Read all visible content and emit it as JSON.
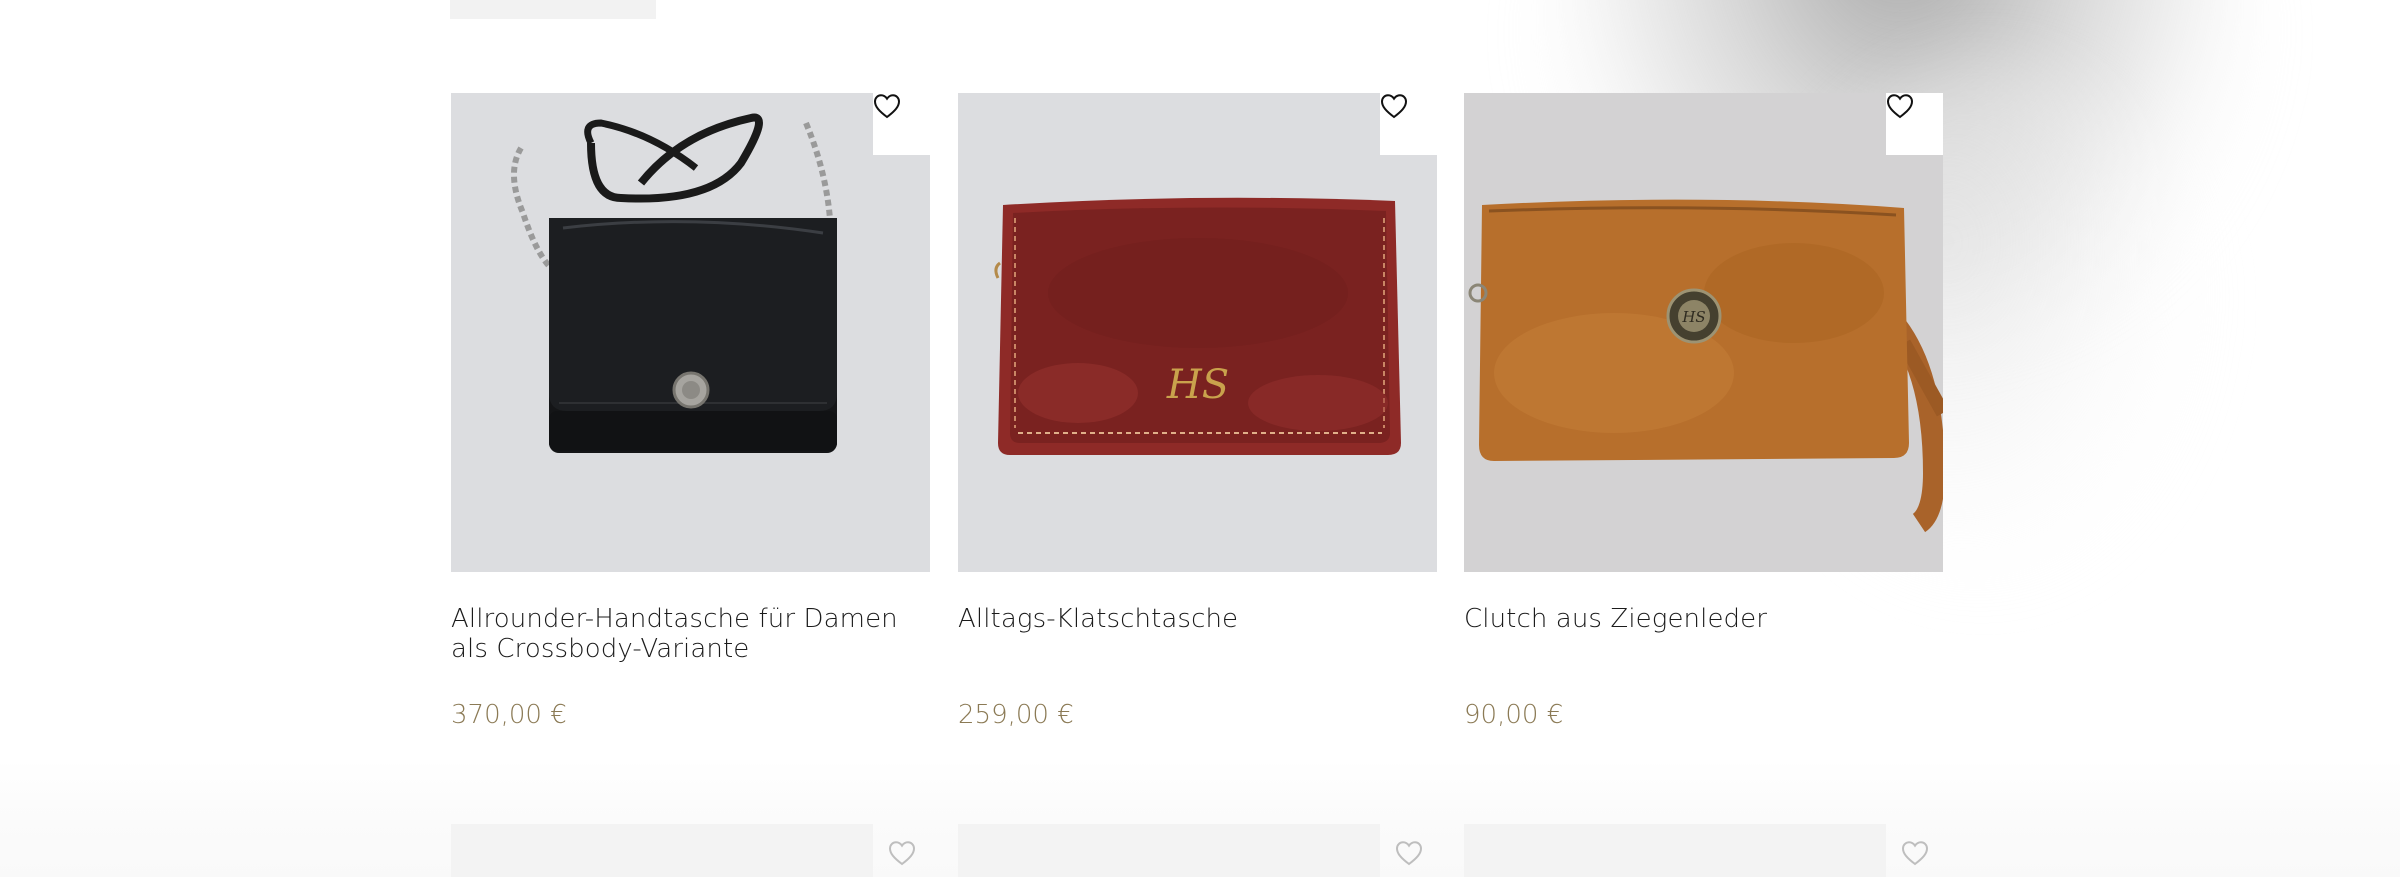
{
  "products": [
    {
      "title": "Allrounder-Handtasche für Damen als Crossbody-Variante",
      "price": "370,00 €",
      "image_alt": "Schwarze Handtasche"
    },
    {
      "title": "Alltags-Klatschtasche",
      "price": "259,00 €",
      "image_alt": "Rote Klatschtasche"
    },
    {
      "title": "Clutch aus Ziegenleder",
      "price": "90,00 €",
      "image_alt": "Braune Clutch aus Ziegenleder"
    }
  ],
  "icons": {
    "wishlist": "heart-outline-icon"
  },
  "colors": {
    "price": "#8b7a55",
    "image_background": "#dcdde0",
    "title_text": "#1b1b1b",
    "bag_black": "#141517",
    "bag_red": "#8e2a27",
    "bag_brown": "#b76f2c"
  }
}
